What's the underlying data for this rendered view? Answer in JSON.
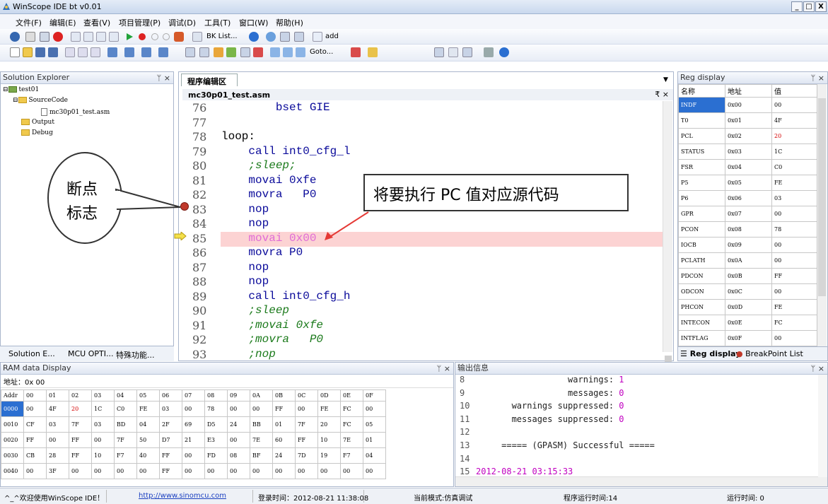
{
  "window": {
    "title": "WinScope IDE bt v0.01",
    "controls": [
      "_",
      "□",
      "X"
    ]
  },
  "menu": [
    "文件(F)",
    "编辑(E)",
    "查看(V)",
    "项目管理(P)",
    "调试(D)",
    "工具(T)",
    "窗口(W)",
    "帮助(H)"
  ],
  "toolbar": {
    "bk_list": "BK List...",
    "add": "add",
    "goto": "Goto..."
  },
  "solution_explorer": {
    "title": "Solution Explorer",
    "tree": [
      "test01",
      "SourceCode",
      "mc30p01_test.asm",
      "Output",
      "Debug"
    ],
    "tabs": [
      "Solution E...",
      "MCU OPTI...",
      "特殊功能..."
    ]
  },
  "editor": {
    "doc_tab": "程序编辑区",
    "file_tab": "mc30p01_test.asm",
    "lines": [
      {
        "n": "76",
        "text": "        bset GIE",
        "kind": "kw"
      },
      {
        "n": "77",
        "text": "",
        "kind": "kw"
      },
      {
        "n": "78",
        "text": "loop:",
        "kind": "lbl"
      },
      {
        "n": "79",
        "text": "    call int0_cfg_l",
        "kind": "kw"
      },
      {
        "n": "80",
        "text": "    ;sleep;",
        "kind": "cm"
      },
      {
        "n": "81",
        "text": "    movai 0xfe",
        "kind": "kw"
      },
      {
        "n": "82",
        "text": "    movra   P0",
        "kind": "kw"
      },
      {
        "n": "83",
        "text": "    nop",
        "kind": "kw"
      },
      {
        "n": "84",
        "text": "    nop",
        "kind": "kw"
      },
      {
        "n": "85",
        "text": "    movai 0x00",
        "kind": "hl"
      },
      {
        "n": "86",
        "text": "    movra P0",
        "kind": "kw"
      },
      {
        "n": "87",
        "text": "    nop",
        "kind": "kw"
      },
      {
        "n": "88",
        "text": "    nop",
        "kind": "kw"
      },
      {
        "n": "89",
        "text": "    call int0_cfg_h",
        "kind": "kw"
      },
      {
        "n": "90",
        "text": "    ;sleep",
        "kind": "cm"
      },
      {
        "n": "91",
        "text": "    ;movai 0xfe",
        "kind": "cm"
      },
      {
        "n": "92",
        "text": "    ;movra   P0",
        "kind": "cm"
      },
      {
        "n": "93",
        "text": "    ;nop",
        "kind": "cm"
      }
    ],
    "breakpoint_line": "83",
    "current_line": "85"
  },
  "annotations": {
    "breakpoint_callout": "断点\n标志",
    "pc_callout": "将要执行 PC 值对应源代码"
  },
  "reg_display": {
    "title": "Reg display",
    "headers": [
      "名称",
      "地址",
      "值"
    ],
    "rows": [
      [
        "INDF",
        "0x00",
        "00",
        false
      ],
      [
        "T0",
        "0x01",
        "4F",
        false
      ],
      [
        "PCL",
        "0x02",
        "20",
        true
      ],
      [
        "STATUS",
        "0x03",
        "1C",
        false
      ],
      [
        "FSR",
        "0x04",
        "C0",
        false
      ],
      [
        "P5",
        "0x05",
        "FE",
        false
      ],
      [
        "P6",
        "0x06",
        "03",
        false
      ],
      [
        "GPR",
        "0x07",
        "00",
        false
      ],
      [
        "PCON",
        "0x08",
        "78",
        false
      ],
      [
        "IOCB",
        "0x09",
        "00",
        false
      ],
      [
        "PCLATH",
        "0x0A",
        "00",
        false
      ],
      [
        "PDCON",
        "0x0B",
        "FF",
        false
      ],
      [
        "ODCON",
        "0x0C",
        "00",
        false
      ],
      [
        "PHCON",
        "0x0D",
        "FE",
        false
      ],
      [
        "INTECON",
        "0x0E",
        "FC",
        false
      ],
      [
        "INTFLAG",
        "0x0F",
        "00",
        false
      ]
    ],
    "tabs": [
      "Reg display",
      "BreakPoint List"
    ]
  },
  "ram": {
    "title": "RAM data Display",
    "address_label": "地址：0x",
    "address_value": "00",
    "headers": [
      "Addr",
      "00",
      "01",
      "02",
      "03",
      "04",
      "05",
      "06",
      "07",
      "08",
      "09",
      "0A",
      "0B",
      "0C",
      "0D",
      "0E",
      "0F"
    ],
    "rows": [
      [
        "0000",
        "00",
        "4F",
        "20",
        "1C",
        "C0",
        "FE",
        "03",
        "00",
        "78",
        "00",
        "00",
        "FF",
        "00",
        "FE",
        "FC",
        "00"
      ],
      [
        "0010",
        "CF",
        "03",
        "7F",
        "03",
        "BD",
        "04",
        "2F",
        "69",
        "D5",
        "24",
        "BB",
        "01",
        "7F",
        "20",
        "FC",
        "05"
      ],
      [
        "0020",
        "FF",
        "00",
        "FF",
        "00",
        "7F",
        "50",
        "D7",
        "21",
        "E3",
        "00",
        "7E",
        "60",
        "FF",
        "10",
        "7E",
        "01"
      ],
      [
        "0030",
        "CB",
        "28",
        "FF",
        "10",
        "F7",
        "40",
        "FF",
        "00",
        "FD",
        "08",
        "BF",
        "24",
        "7D",
        "19",
        "F7",
        "04"
      ],
      [
        "0040",
        "00",
        "3F",
        "00",
        "00",
        "00",
        "00",
        "FF",
        "00",
        "00",
        "00",
        "00",
        "00",
        "00",
        "00",
        "00",
        "00"
      ]
    ]
  },
  "output": {
    "title": "输出信息",
    "lines": [
      {
        "n": "8",
        "label": "                  warnings: ",
        "val": "1"
      },
      {
        "n": "9",
        "label": "                  messages: ",
        "val": "0"
      },
      {
        "n": "10",
        "label": "       warnings suppressed: ",
        "val": "0"
      },
      {
        "n": "11",
        "label": "       messages suppressed: ",
        "val": "0"
      },
      {
        "n": "12",
        "label": "",
        "val": ""
      },
      {
        "n": "13",
        "label": "     ===== (GPASM) Successful =====",
        "val": ""
      },
      {
        "n": "14",
        "label": "",
        "val": ""
      },
      {
        "n": "15",
        "label": "",
        "val": "2012-08-21 03:15:33"
      }
    ]
  },
  "status": {
    "welcome": "^_^欢迎使用WinScope IDE！",
    "url": "http://www.sinomcu.com",
    "login": "登录时间：2012-08-21 11:38:08",
    "mode": "当前模式:仿真调试",
    "prog_time": "程序运行时间:14",
    "run_time": "运行时间: 0"
  },
  "colors": {
    "highlight": "#fcd3d3",
    "breakpoint": "#c0392b",
    "arrow": "#e53935",
    "keyword": "#0a0a9a",
    "comment": "#1b7a1b",
    "magenta": "#c000c0"
  }
}
